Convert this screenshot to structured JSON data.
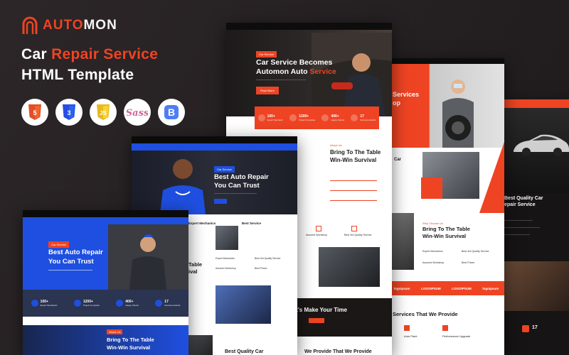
{
  "brand": {
    "logo_a": "AUTO",
    "logo_b": "MON",
    "accent": "#ee4423",
    "blue": "#1f4fe0"
  },
  "headline": {
    "line1_a": "Car ",
    "line1_b": "Repair",
    "line1_c": " Service",
    "line2": "HTML Template"
  },
  "tech": [
    {
      "name": "html5-icon",
      "label": "HTML",
      "num": "5",
      "color": "#e44d26"
    },
    {
      "name": "css3-icon",
      "label": "CSS",
      "num": "3",
      "color": "#264de4"
    },
    {
      "name": "js-icon",
      "label": "JS",
      "num": "",
      "color": "#f0c419"
    },
    {
      "name": "sass-icon",
      "label": "Sass",
      "num": "",
      "color": "#cd6799"
    },
    {
      "name": "bootstrap-icon",
      "label": "B",
      "num": "",
      "color": "#7952b3"
    }
  ],
  "m1": {
    "tag": "Car Service",
    "title1": "Car Service Becomes",
    "title2a": "Automon Auto ",
    "title2b": "Service",
    "btn": "Read More",
    "stats": [
      {
        "val": "100+",
        "lbl": "Expert Mechanic"
      },
      {
        "val": "1200+",
        "lbl": "Project Complete"
      },
      {
        "val": "400+",
        "lbl": "Happy Clients"
      },
      {
        "val": "17",
        "lbl": "Success Awards"
      }
    ],
    "kicker": "About Us",
    "about1": "Bring To The Table",
    "about2": "Win-Win Survival",
    "srv1": "Assured Workshop",
    "srv2": "Best 3rd Quality Service",
    "cta": "It's Make Your Time",
    "last": "We Provide That We Provide"
  },
  "m2": {
    "tag": "Car Service",
    "title1": "Best Auto Repair",
    "title2": "You Can Trust",
    "col1": "Expert Mechanics",
    "col2": "Best Service",
    "list": [
      "Expert Mechanics",
      "Best 3rd Quality Service",
      "Assured Workshop",
      "Best Prices"
    ],
    "about_part1": "Table",
    "about_part2": "ival",
    "bottom": "Best Quality Car"
  },
  "m3": {
    "tag": "Car Service",
    "title1": "Best Auto Repair",
    "title2": "You Can Trust",
    "stats": [
      {
        "val": "100+",
        "lbl": "Expert Mechanics"
      },
      {
        "val": "1200+",
        "lbl": "Project Complete"
      },
      {
        "val": "400+",
        "lbl": "Happy Clients"
      },
      {
        "val": "17",
        "lbl": "Success Awards"
      }
    ],
    "kicker": "About Us",
    "about1": "Bring To The Table",
    "about2": "Win-Win Survival"
  },
  "m4": {
    "hero1": "Services",
    "hero2": "op",
    "srv1": "Car",
    "kicker": "Why Choose Us",
    "about1": "Bring To The Table",
    "about2": "Win-Win Survival",
    "list": [
      "Expert Mechanics",
      "Best 3rd Quality Service",
      "Assured Workshop",
      "Best Prices"
    ],
    "logos": [
      "logoipsum",
      "LOGOIPSUM",
      "LOGOIPSUM",
      "logoipsum"
    ],
    "services_title": "Services That We Provide",
    "card1": "Auto Paint",
    "card2": "Performance Upgrade"
  },
  "m5": {
    "title1": "Best Quality Car",
    "title2": "epair Service",
    "stat": "17"
  }
}
